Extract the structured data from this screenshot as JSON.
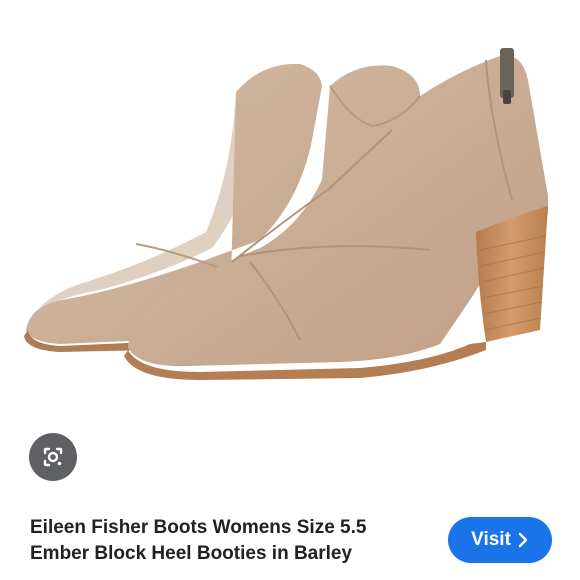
{
  "product": {
    "title_line1": "Eileen Fisher Boots Womens Size 5.5",
    "title_line2": "Ember Block Heel Booties in Barley",
    "image_icon": "ankle-boots-photo"
  },
  "actions": {
    "lens_icon": "camera-search-icon",
    "visit_label": "Visit",
    "visit_icon": "chevron-right-icon"
  },
  "colors": {
    "accent": "#1a73e8",
    "suede": "#cdb19a",
    "heel_wood": "#c68c5e",
    "lens_bg": "#5f6063"
  }
}
